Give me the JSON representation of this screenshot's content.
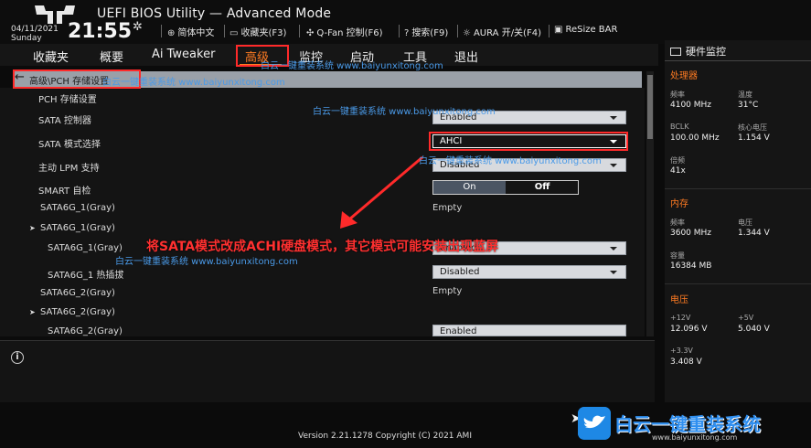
{
  "header": {
    "title": "UEFI BIOS Utility — Advanced Mode",
    "date": "04/11/2021",
    "day": "Sunday",
    "time": "21:55",
    "tools": [
      {
        "icon": "globe-icon",
        "label": "简体中文"
      },
      {
        "icon": "bookmark-icon",
        "label": "收藏夹(F3)"
      },
      {
        "icon": "fan-icon",
        "label": "Q-Fan 控制(F6)"
      },
      {
        "icon": "help-icon",
        "label": "搜索(F9)"
      },
      {
        "icon": "aura-icon",
        "label": "AURA 开/关(F4)"
      },
      {
        "icon": "resize-bar-icon",
        "label": "ReSize BAR"
      }
    ]
  },
  "nav": {
    "tabs": [
      {
        "label": "收藏夹"
      },
      {
        "label": "概要"
      },
      {
        "label": "Ai Tweaker"
      },
      {
        "label": "高级",
        "active": true
      },
      {
        "label": "监控"
      },
      {
        "label": "启动"
      },
      {
        "label": "工具"
      },
      {
        "label": "退出"
      }
    ]
  },
  "breadcrumb": {
    "text": "高级\\PCH 存储设置"
  },
  "settings": {
    "section_title": "PCH 存储设置",
    "sata_controller": {
      "label": "SATA 控制器",
      "value": "Enabled"
    },
    "sata_mode": {
      "label": "SATA 模式选择",
      "value": "AHCI"
    },
    "lpm": {
      "label": "主动 LPM 支持",
      "value": "Disabled"
    },
    "smart": {
      "label": "SMART 自检",
      "on": "On",
      "off": "Off"
    },
    "port1_header": {
      "label": "SATA6G_1(Gray)",
      "value": "Empty"
    },
    "port1_group": {
      "label": "SATA6G_1(Gray)"
    },
    "port1_enable": {
      "label": "SATA6G_1(Gray)",
      "value": "Enabled"
    },
    "port1_hotplug": {
      "label": "SATA6G_1 热插拔",
      "value": "Disabled"
    },
    "port2_header": {
      "label": "SATA6G_2(Gray)",
      "value": "Empty"
    },
    "port2_group": {
      "label": "SATA6G_2(Gray)"
    },
    "port2_enable": {
      "label": "SATA6G_2(Gray)",
      "value": "Enabled"
    }
  },
  "hw_monitor": {
    "title": "硬件监控",
    "cpu": {
      "section": "处理器",
      "freq_label": "频率",
      "freq": "4100 MHz",
      "temp_label": "温度",
      "temp": "31°C",
      "bclk_label": "BCLK",
      "bclk": "100.00 MHz",
      "vcore_label": "核心电压",
      "vcore": "1.154 V",
      "ratio_label": "倍频",
      "ratio": "41x"
    },
    "memory": {
      "section": "内存",
      "freq_label": "频率",
      "freq": "3600 MHz",
      "volt_label": "电压",
      "volt": "1.344 V",
      "cap_label": "容量",
      "cap": "16384 MB"
    },
    "voltage": {
      "section": "电压",
      "v12_label": "+12V",
      "v12": "12.096 V",
      "v5_label": "+5V",
      "v5": "5.040 V",
      "v33_label": "+3.3V",
      "v33": "3.408 V"
    }
  },
  "footer": {
    "version": "Version 2.21.1278 Copyright (C) 2021 AMI"
  },
  "annotation": {
    "text": "将SATA模式改成ACHI硬盘模式，其它模式可能安装出现蓝屏"
  },
  "watermark": {
    "text": "白云一键重装系统 www.baiyunxitong.com",
    "brand": "白云一键重装系统",
    "brand_url": "www.baiyunxitong.com"
  },
  "colors": {
    "accent": "#ff7b22",
    "highlight": "#ff2a2a",
    "watermark": "#4a9ae8"
  }
}
